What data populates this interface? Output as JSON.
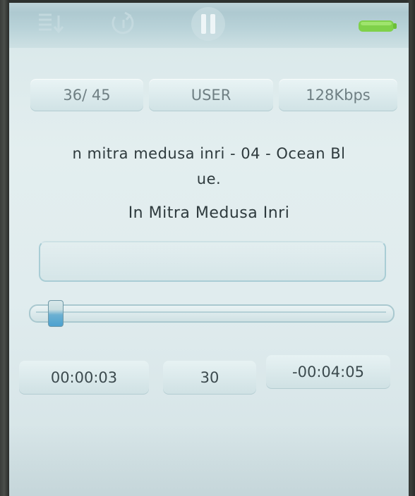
{
  "status_bar": {
    "icons": [
      "playlist-order-icon",
      "repeat-icon",
      "pause-icon",
      "battery-icon"
    ],
    "battery_color": "#7fd14a"
  },
  "info": {
    "track_counter": "36/ 45",
    "eq_mode": "USER",
    "bitrate": "128Kbps"
  },
  "song": {
    "filename_line1": "n mitra medusa inri - 04 - Ocean Bl",
    "filename_line2": "ue.",
    "artist": "In Mitra Medusa Inri"
  },
  "playback": {
    "progress_fraction": 0.03,
    "elapsed": "00:00:03",
    "volume": "30",
    "remaining": "-00:04:05"
  },
  "colors": {
    "screen_bg": "#e0ecee",
    "topbar_bg": "#b8d2d8",
    "accent": "#4ca1cf"
  }
}
